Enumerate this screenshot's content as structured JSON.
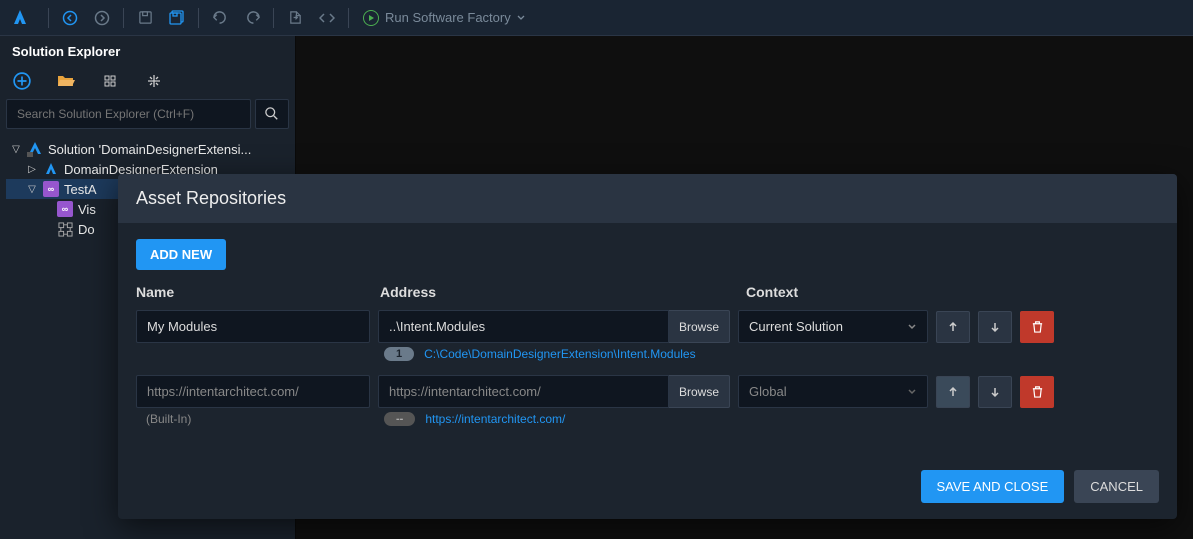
{
  "toolbar": {
    "run_label": "Run Software Factory"
  },
  "sidebar": {
    "title": "Solution Explorer",
    "search_placeholder": "Search Solution Explorer (Ctrl+F)",
    "tree": {
      "root": "Solution 'DomainDesignerExtensi...",
      "items": [
        "DomainDesignerExtension",
        "TestA",
        "Vis",
        "Do"
      ]
    }
  },
  "dialog": {
    "title": "Asset Repositories",
    "add_new": "ADD NEW",
    "headers": {
      "name": "Name",
      "address": "Address",
      "context": "Context"
    },
    "rows": [
      {
        "name": "My Modules",
        "address": "..\\Intent.Modules",
        "browse": "Browse",
        "context": "Current Solution",
        "badge": "1",
        "resolved": "C:\\Code\\DomainDesignerExtension\\Intent.Modules",
        "sub_name": ""
      },
      {
        "name": "https://intentarchitect.com/",
        "address": "https://intentarchitect.com/",
        "browse": "Browse",
        "context": "Global",
        "badge": "--",
        "resolved": "https://intentarchitect.com/",
        "sub_name": "(Built-In)"
      }
    ],
    "footer": {
      "save": "SAVE AND CLOSE",
      "cancel": "CANCEL"
    }
  }
}
